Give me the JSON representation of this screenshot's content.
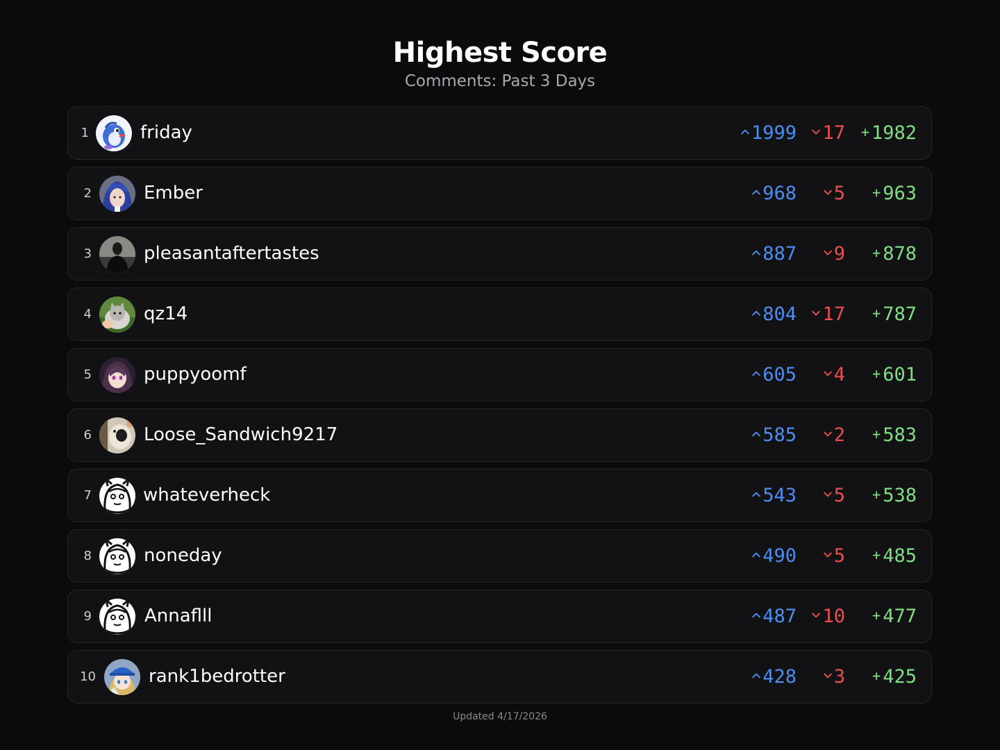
{
  "header": {
    "title": "Highest Score",
    "subtitle": "Comments: Past 3 Days"
  },
  "icons": {
    "up": "chevron-up-icon",
    "down": "chevron-down-icon"
  },
  "colors": {
    "background": "#0b0b0d",
    "row_background": "#121215",
    "upvotes": "#4b8ef2",
    "downvotes": "#ea4f4f",
    "net": "#7ee083"
  },
  "rows": [
    {
      "rank": "1",
      "username": "friday",
      "upvotes": "1999",
      "downvotes": "17",
      "net": "1982"
    },
    {
      "rank": "2",
      "username": "Ember",
      "upvotes": "968",
      "downvotes": "5",
      "net": "963"
    },
    {
      "rank": "3",
      "username": "pleasantaftertastes",
      "upvotes": "887",
      "downvotes": "9",
      "net": "878"
    },
    {
      "rank": "4",
      "username": "qz14",
      "upvotes": "804",
      "downvotes": "17",
      "net": "787"
    },
    {
      "rank": "5",
      "username": "puppyoomf",
      "upvotes": "605",
      "downvotes": "4",
      "net": "601"
    },
    {
      "rank": "6",
      "username": "Loose_Sandwich9217",
      "upvotes": "585",
      "downvotes": "2",
      "net": "583"
    },
    {
      "rank": "7",
      "username": "whateverheck",
      "upvotes": "543",
      "downvotes": "5",
      "net": "538"
    },
    {
      "rank": "8",
      "username": "noneday",
      "upvotes": "490",
      "downvotes": "5",
      "net": "485"
    },
    {
      "rank": "9",
      "username": "Annaflll",
      "upvotes": "487",
      "downvotes": "10",
      "net": "477"
    },
    {
      "rank": "10",
      "username": "rank1bedrotter",
      "upvotes": "428",
      "downvotes": "3",
      "net": "425"
    }
  ],
  "footer": {
    "updated": "Updated 4/17/2026"
  }
}
